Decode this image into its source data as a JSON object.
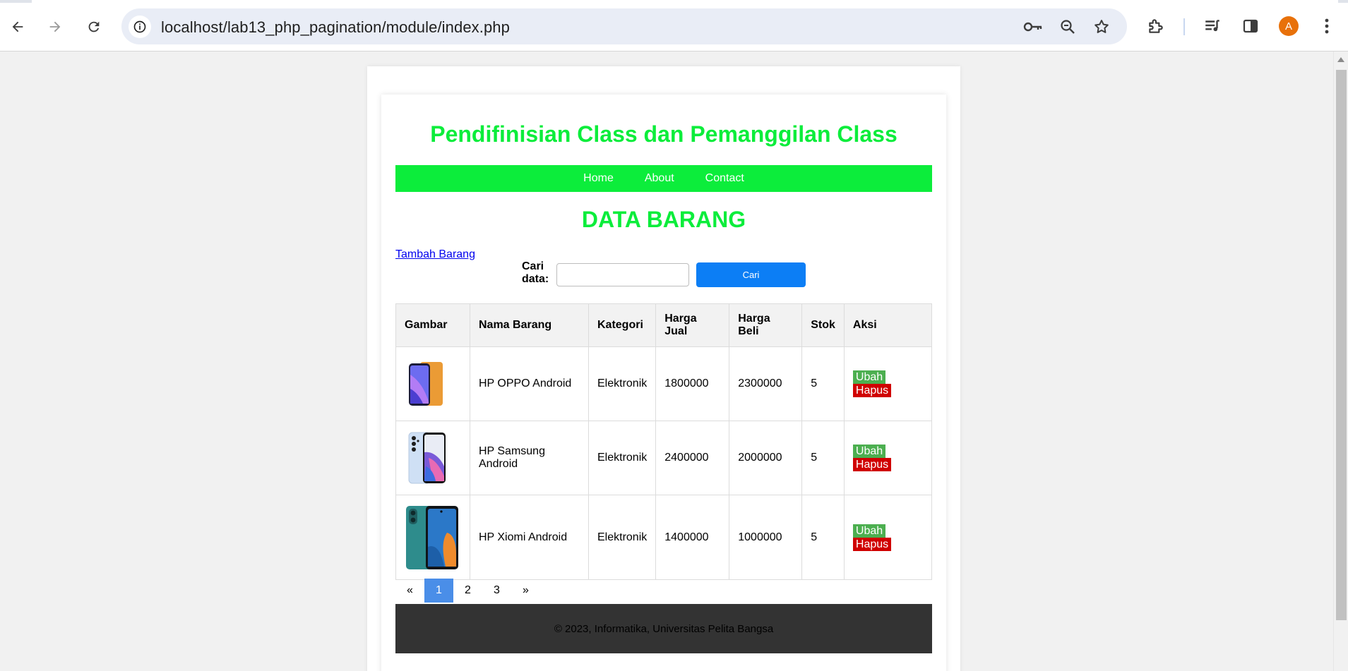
{
  "browser": {
    "url": "localhost/lab13_php_pagination/module/index.php",
    "profile_initial": "A",
    "icons": [
      "back-icon",
      "forward-icon",
      "reload-icon",
      "site-info-icon",
      "password-key-icon",
      "zoom-out-icon",
      "bookmark-star-icon",
      "extensions-icon",
      "media-queue-icon",
      "side-panel-icon",
      "profile-avatar",
      "more-menu-icon"
    ]
  },
  "page": {
    "site_title": "Pendifinisian Class dan Pemanggilan Class",
    "nav": {
      "home": "Home",
      "about": "About",
      "contact": "Contact"
    },
    "section_title": "DATA BARANG",
    "add_link": "Tambah Barang",
    "search": {
      "label": "Cari data:",
      "value": "",
      "placeholder": "",
      "button": "Cari"
    },
    "table": {
      "headers": {
        "gambar": "Gambar",
        "nama": "Nama Barang",
        "kategori": "Kategori",
        "harga_jual": "Harga Jual",
        "harga_beli": "Harga Beli",
        "stok": "Stok",
        "aksi": "Aksi"
      },
      "rows": [
        {
          "nama": "HP OPPO Android",
          "kategori": "Elektronik",
          "harga_jual": "1800000",
          "harga_beli": "2300000",
          "stok": "5",
          "edit": "Ubah",
          "delete": "Hapus"
        },
        {
          "nama": "HP Samsung Android",
          "kategori": "Elektronik",
          "harga_jual": "2400000",
          "harga_beli": "2000000",
          "stok": "5",
          "edit": "Ubah",
          "delete": "Hapus"
        },
        {
          "nama": "HP Xiomi Android",
          "kategori": "Elektronik",
          "harga_jual": "1400000",
          "harga_beli": "1000000",
          "stok": "5",
          "edit": "Ubah",
          "delete": "Hapus"
        }
      ]
    },
    "pagination": {
      "prev": "«",
      "pages": [
        "1",
        "2",
        "3"
      ],
      "current": "1",
      "next": "»"
    },
    "footer": "© 2023, Informatika, Universitas Pelita Bangsa"
  },
  "colors": {
    "accent_green": "#0ced3b",
    "search_button": "#0c7ef5",
    "edit_button": "#4caf50",
    "delete_button": "#d00000",
    "pagination_active": "#4a8ee8",
    "footer_bg": "#333333"
  }
}
